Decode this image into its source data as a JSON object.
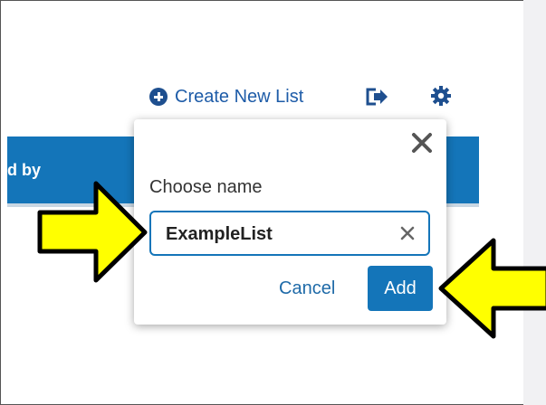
{
  "header": {
    "create_list_label": "Create New List"
  },
  "table": {
    "header_fragment": "d by"
  },
  "dialog": {
    "label": "Choose name",
    "input_value": "ExampleList",
    "cancel_label": "Cancel",
    "add_label": "Add"
  },
  "colors": {
    "accent": "#1475b9",
    "annotation_arrow": "#ffff00"
  },
  "icons": [
    "plus-circle-icon",
    "export-icon",
    "gear-icon",
    "close-icon",
    "clear-icon",
    "arrow-annotation"
  ]
}
